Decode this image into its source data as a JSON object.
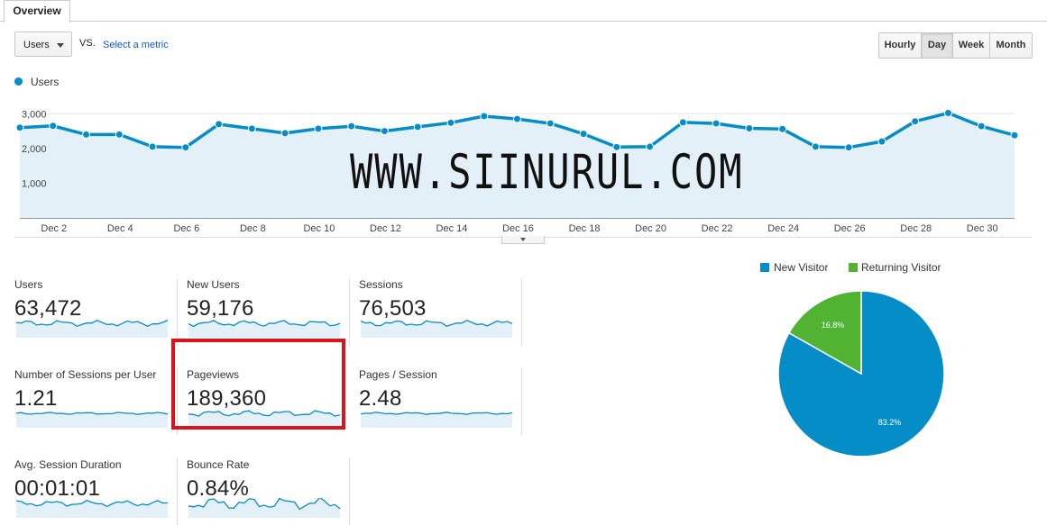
{
  "tab": {
    "label": "Overview"
  },
  "metric_selector": {
    "value": "Users",
    "vs_label": "VS.",
    "select_metric_label": "Select a metric"
  },
  "granularity": {
    "options": [
      "Hourly",
      "Day",
      "Week",
      "Month"
    ],
    "selected": "Day"
  },
  "chart_data": {
    "type": "area",
    "title": "",
    "series": [
      {
        "name": "Users",
        "values": [
          2600,
          2650,
          2400,
          2400,
          2050,
          2030,
          2700,
          2570,
          2440,
          2570,
          2640,
          2500,
          2620,
          2740,
          2930,
          2850,
          2720,
          2420,
          2040,
          2050,
          2750,
          2720,
          2580,
          2560,
          2050,
          2030,
          2200,
          2780,
          3020,
          2640,
          2380
        ]
      }
    ],
    "x_tick_labels": [
      "Dec 2",
      "Dec 4",
      "Dec 6",
      "Dec 8",
      "Dec 10",
      "Dec 12",
      "Dec 14",
      "Dec 16",
      "Dec 18",
      "Dec 20",
      "Dec 22",
      "Dec 24",
      "Dec 26",
      "Dec 28",
      "Dec 30"
    ],
    "y_tick_labels": [
      "3,000",
      "2,000",
      "1,000"
    ],
    "ylim": [
      0,
      3500
    ],
    "color": "#058dc7",
    "fill": "#e3f0f8"
  },
  "watermark": "WWW.SIINURUL.COM",
  "metrics": [
    {
      "label": "Users",
      "value": "63,472"
    },
    {
      "label": "New Users",
      "value": "59,176"
    },
    {
      "label": "Sessions",
      "value": "76,503"
    },
    {
      "label": "Number of Sessions per User",
      "value": "1.21"
    },
    {
      "label": "Pageviews",
      "value": "189,360"
    },
    {
      "label": "Pages / Session",
      "value": "2.48"
    },
    {
      "label": "Avg. Session Duration",
      "value": "00:01:01"
    },
    {
      "label": "Bounce Rate",
      "value": "0.84%"
    }
  ],
  "pie": {
    "legend": [
      {
        "name": "New Visitor",
        "color": "#058dc7"
      },
      {
        "name": "Returning Visitor",
        "color": "#50b432"
      }
    ],
    "chart_data": {
      "type": "pie",
      "slices": [
        {
          "name": "New Visitor",
          "value": 83.2,
          "label": "83.2%",
          "color": "#058dc7"
        },
        {
          "name": "Returning Visitor",
          "value": 16.8,
          "label": "16.8%",
          "color": "#50b432"
        }
      ]
    }
  }
}
